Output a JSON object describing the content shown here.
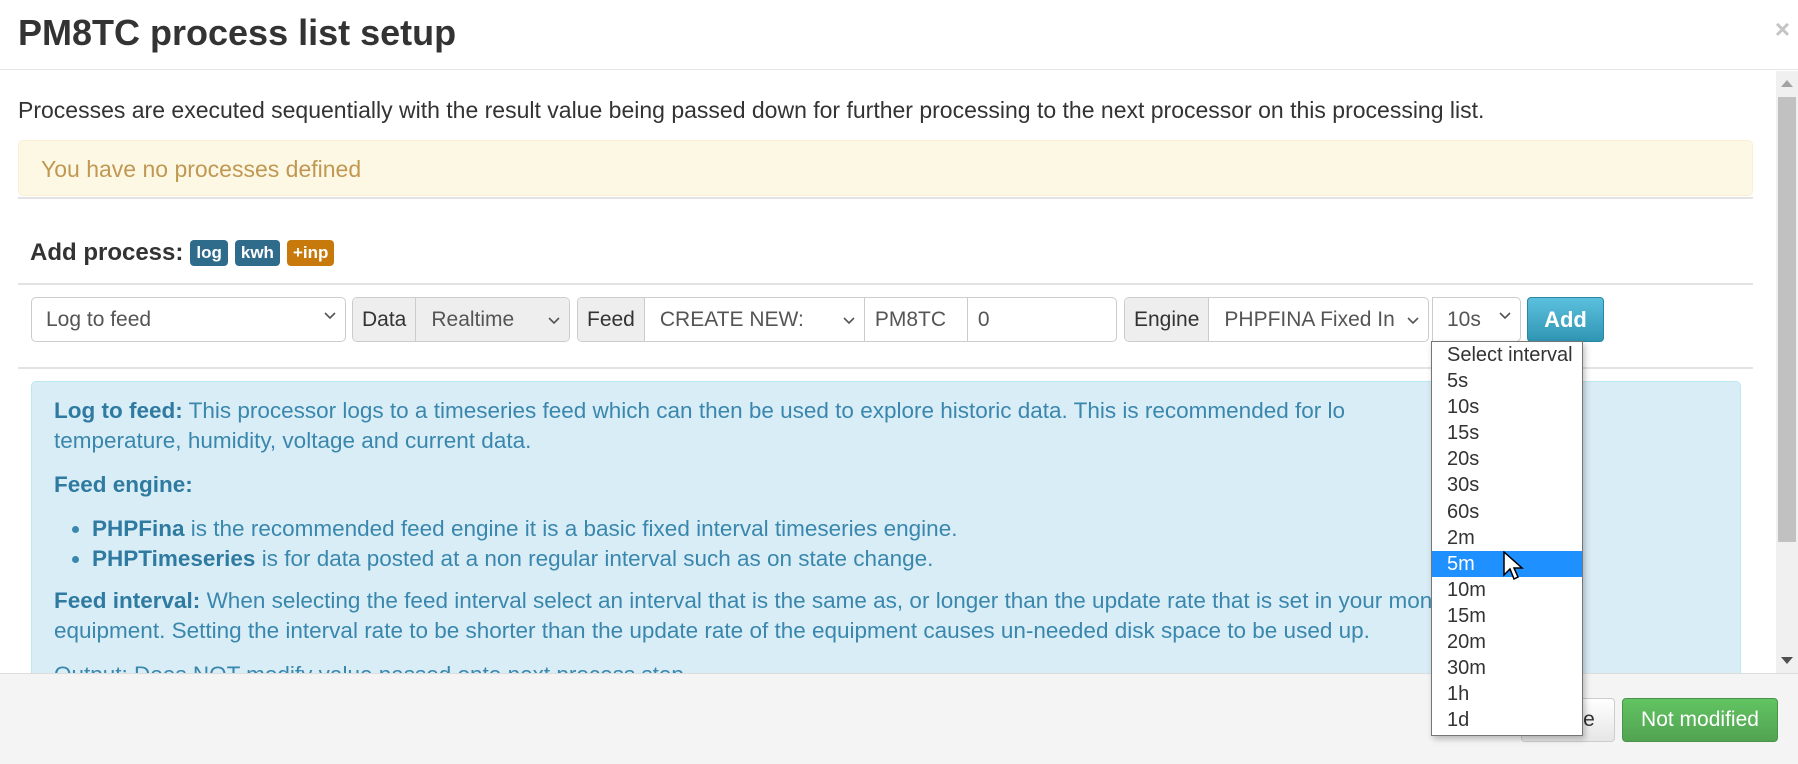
{
  "modal": {
    "title": "PM8TC process list setup",
    "close_glyph": "×"
  },
  "body": {
    "description": "Processes are executed sequentially with the result value being passed down for further processing to the next processor on this processing list.",
    "alert": "You have no processes defined",
    "add_process": {
      "label": "Add process:",
      "badges": [
        {
          "label": "log",
          "color": "#2f6b8a"
        },
        {
          "label": "kwh",
          "color": "#2f6b8a"
        },
        {
          "label": "+inp",
          "color": "#c77a0b"
        }
      ]
    },
    "controls": {
      "process_select": "Log to feed",
      "data_label": "Data",
      "data_select": "Realtime",
      "feed_label": "Feed",
      "feed_select": "CREATE NEW:",
      "feed_tag": "PM8TC",
      "feed_name": "0",
      "engine_label": "Engine",
      "engine_select": "PHPFINA Fixed In",
      "interval_select": "10s",
      "add_button": "Add"
    },
    "info": {
      "log_to_feed_title": "Log to feed:",
      "log_to_feed_text": "This processor logs to a timeseries feed which can then be used to explore historic data. This is recommended for lo",
      "log_to_feed_text2": "temperature, humidity, voltage and current data.",
      "feed_engine_title": "Feed engine:",
      "engines": [
        {
          "name": "PHPFina",
          "text": "is the recommended feed engine it is a basic fixed interval timeseries engine."
        },
        {
          "name": "PHPTimeseries",
          "text": "is for data posted at a non regular interval such as on state change."
        }
      ],
      "feed_interval_title": "Feed interval:",
      "feed_interval_text": "When selecting the feed interval select an interval that is the same as, or longer than the update rate that is set in your monitoring",
      "feed_interval_text2": "equipment. Setting the interval rate to be shorter than the update rate of the equipment causes un-needed disk space to be used up.",
      "output_partial": "Output: Does NOT modify value passed onto next process step."
    }
  },
  "interval_dropdown": {
    "options": [
      "Select interval",
      "5s",
      "10s",
      "15s",
      "20s",
      "30s",
      "60s",
      "2m",
      "5m",
      "10m",
      "15m",
      "20m",
      "30m",
      "1h",
      "1d"
    ],
    "highlighted": "5m"
  },
  "footer": {
    "close_button": "Close",
    "save_button": "Not modified"
  }
}
